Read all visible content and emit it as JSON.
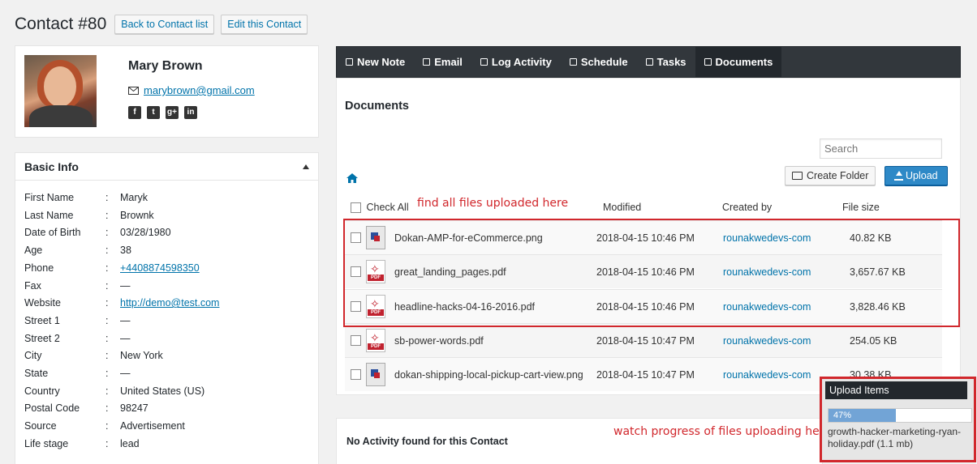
{
  "header": {
    "title": "Contact #80",
    "back_label": "Back to Contact list",
    "edit_label": "Edit this Contact"
  },
  "profile": {
    "name": "Mary Brown",
    "email": "marybrown@gmail.com",
    "social": [
      "facebook-icon",
      "twitter-icon",
      "google-plus-icon",
      "linkedin-icon"
    ]
  },
  "basic_info": {
    "title": "Basic Info",
    "rows": [
      {
        "label": "First Name",
        "value": "Maryk"
      },
      {
        "label": "Last Name",
        "value": "Brownk"
      },
      {
        "label": "Date of Birth",
        "value": "03/28/1980"
      },
      {
        "label": "Age",
        "value": "38"
      },
      {
        "label": "Phone",
        "value": "+4408874598350",
        "link": true
      },
      {
        "label": "Fax",
        "value": "—"
      },
      {
        "label": "Website",
        "value": "http://demo@test.com",
        "link": true
      },
      {
        "label": "Street 1",
        "value": "—"
      },
      {
        "label": "Street 2",
        "value": "—"
      },
      {
        "label": "City",
        "value": "New York"
      },
      {
        "label": "State",
        "value": "—"
      },
      {
        "label": "Country",
        "value": "United States (US)"
      },
      {
        "label": "Postal Code",
        "value": "98247"
      },
      {
        "label": "Source",
        "value": "Advertisement"
      },
      {
        "label": "Life stage",
        "value": "lead"
      }
    ]
  },
  "tabs": [
    {
      "label": "New Note",
      "icon": "note-icon"
    },
    {
      "label": "Email",
      "icon": "envelope-icon"
    },
    {
      "label": "Log Activity",
      "icon": "list-icon"
    },
    {
      "label": "Schedule",
      "icon": "calendar-icon"
    },
    {
      "label": "Tasks",
      "icon": "check-icon"
    },
    {
      "label": "Documents",
      "icon": "document-icon",
      "active": true
    }
  ],
  "documents": {
    "title": "Documents",
    "search_placeholder": "Search",
    "create_folder_label": "Create Folder",
    "upload_label": "Upload",
    "columns": {
      "check_all": "Check All",
      "modified": "Modified",
      "created_by": "Created by",
      "file_size": "File size"
    },
    "files": [
      {
        "name": "Dokan-AMP-for-eCommerce.png",
        "type": "png",
        "modified": "2018-04-15 10:46 PM",
        "created_by": "rounakwedevs-com",
        "size": "40.82 KB"
      },
      {
        "name": "great_landing_pages.pdf",
        "type": "pdf",
        "modified": "2018-04-15 10:46 PM",
        "created_by": "rounakwedevs-com",
        "size": "3,657.67 KB"
      },
      {
        "name": "headline-hacks-04-16-2016.pdf",
        "type": "pdf",
        "modified": "2018-04-15 10:46 PM",
        "created_by": "rounakwedevs-com",
        "size": "3,828.46 KB"
      },
      {
        "name": "sb-power-words.pdf",
        "type": "pdf",
        "modified": "2018-04-15 10:47 PM",
        "created_by": "rounakwedevs-com",
        "size": "254.05 KB"
      },
      {
        "name": "dokan-shipping-local-pickup-cart-view.png",
        "type": "png",
        "modified": "2018-04-15 10:47 PM",
        "created_by": "rounakwedevs-com",
        "size": "30.38 KB"
      }
    ]
  },
  "annotations": {
    "files_note": "find all files uploaded here",
    "progress_note": "watch progress of files uploading here"
  },
  "activity": {
    "empty_text": "No Activity found for this Contact"
  },
  "upload_panel": {
    "title": "Upload Items",
    "progress_percent": 47,
    "progress_label": "47%",
    "file_label": "growth-hacker-marketing-ryan-holiday.pdf (1.1 mb)"
  },
  "pdf_tag": "PDF"
}
